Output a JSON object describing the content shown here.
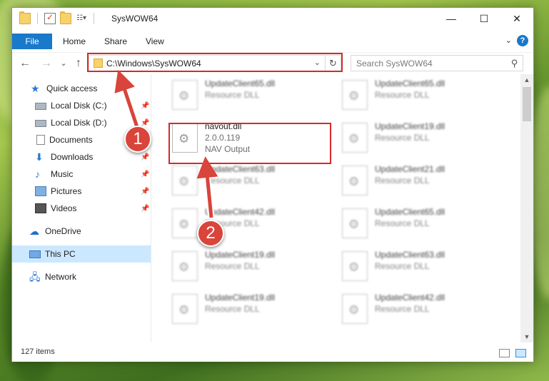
{
  "window": {
    "title": "SysWOW64",
    "controls": {
      "minimize": "—",
      "maximize": "☐",
      "close": "✕"
    }
  },
  "ribbon": {
    "tabs": [
      "File",
      "Home",
      "Share",
      "View"
    ],
    "expand_glyph": "⌄",
    "help_glyph": "?"
  },
  "navigation": {
    "back_glyph": "←",
    "forward_glyph": "→",
    "recent_glyph": "⌄",
    "up_glyph": "↑",
    "address": "C:\\Windows\\SysWOW64",
    "address_drop_glyph": "⌄",
    "refresh_glyph": "↻",
    "search_placeholder": "Search SysWOW64",
    "search_glyph": "⚲"
  },
  "sidebar": {
    "pin_glyph": "📌",
    "items": [
      {
        "label": "Quick access",
        "icon": "star-icon",
        "glyph": "★"
      },
      {
        "label": "Local Disk (C:)",
        "icon": "drive-icon",
        "pinned": true
      },
      {
        "label": "Local Disk (D:)",
        "icon": "drive-icon",
        "pinned": true
      },
      {
        "label": "Documents",
        "icon": "documents-icon",
        "pinned": true
      },
      {
        "label": "Downloads",
        "icon": "downloads-icon",
        "glyph": "⬇",
        "pinned": true
      },
      {
        "label": "Music",
        "icon": "music-icon",
        "glyph": "♪",
        "pinned": true
      },
      {
        "label": "Pictures",
        "icon": "pictures-icon",
        "pinned": true
      },
      {
        "label": "Videos",
        "icon": "videos-icon",
        "pinned": true
      },
      {
        "label": "OneDrive",
        "icon": "onedrive-icon",
        "glyph": "☁"
      },
      {
        "label": "This PC",
        "icon": "computer-icon",
        "selected": true
      },
      {
        "label": "Network",
        "icon": "network-icon",
        "glyph": "🖧"
      }
    ]
  },
  "files": {
    "highlighted": {
      "name": "navout.dll",
      "version": "2.0.0.119",
      "description": "NAV Output"
    },
    "blurred": [
      {
        "name": "UpdateClient65.dll",
        "type": "Resource DLL"
      },
      {
        "name": "UpdateClient65.dll",
        "type": "Resource DLL"
      },
      {
        "name": "UpdateClient19.dll",
        "type": "Resource DLL"
      },
      {
        "name": "UpdateClient63.dll",
        "type": "Resource DLL"
      },
      {
        "name": "UpdateClient21.dll",
        "type": "Resource DLL"
      },
      {
        "name": "UpdateClient42.dll",
        "type": "Resource DLL"
      },
      {
        "name": "UpdateClient65.dll",
        "type": "Resource DLL"
      },
      {
        "name": "UpdateClient19.dll",
        "type": "Resource DLL"
      },
      {
        "name": "UpdateClient63.dll",
        "type": "Resource DLL"
      },
      {
        "name": "UpdateClient19.dll",
        "type": "Resource DLL"
      },
      {
        "name": "UpdateClient42.dll",
        "type": "Resource DLL"
      }
    ]
  },
  "scrollbar": {
    "up_glyph": "▲",
    "down_glyph": "▼"
  },
  "status": {
    "items_count": "127 items"
  },
  "callouts": [
    "1",
    "2"
  ],
  "colors": {
    "accent": "#1979ca",
    "highlight_box": "#d42a2a",
    "callout": "#d9443b",
    "selected_bg": "#cce8ff"
  }
}
